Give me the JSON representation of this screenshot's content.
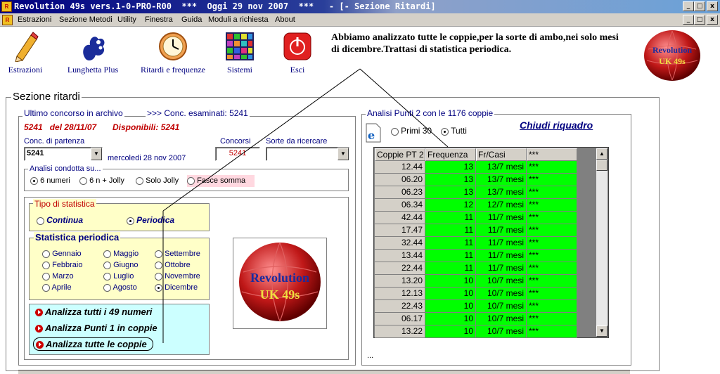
{
  "window": {
    "title": "Revolution 49s vers.1-0-PRO-R00  ***  Oggi 29 nov 2007  ***   - [- Sezione Ritardi]",
    "controls": [
      "_",
      "□",
      "x"
    ]
  },
  "menu": [
    "Estrazioni",
    "Sezione Metodi",
    "Utility",
    "Finestra",
    "Guida",
    "Moduli a richiesta",
    "About"
  ],
  "toolbar": [
    {
      "label": "Estrazioni",
      "icon": "pencil-icon"
    },
    {
      "label": "Lunghetta Plus",
      "icon": "lottery-hand-icon"
    },
    {
      "label": "Ritardi e frequenze",
      "icon": "clock-icon"
    },
    {
      "label": "Sistemi",
      "icon": "grid-icon"
    },
    {
      "label": "Esci",
      "icon": "power-icon"
    }
  ],
  "annotation": "Abbiamo analizzato tutte le coppie,per la sorte di ambo,nei solo mesi di dicembre.Trattasi di statistica periodica.",
  "logo": {
    "line1": "Revolution",
    "line2": "UK 49s"
  },
  "section_title": "Sezione ritardi",
  "left": {
    "frame_title": "Ultimo concorso in archivo",
    "examined": ">>> Conc. esaminati: 5241",
    "last_draw": "5241   del 28/11/07",
    "available": "Disponibili: 5241",
    "start_label": "Conc. di partenza",
    "start_value": "5241",
    "start_date": "mercoledi 28 nov 2007",
    "concorsi_label": "Concorsi",
    "concorsi_value": "5241",
    "sorte_label": "Sorte da ricercare",
    "sorte_value": "",
    "analisi_title": "Analisi condotta su...",
    "analisi_options": [
      "6 numeri",
      "6 n + Jolly",
      "Solo Jolly",
      "Fasce somma"
    ],
    "analisi_selected": "6 numeri",
    "tipo_title": "Tipo di statistica",
    "tipo_options": [
      "Continua",
      "Periodica"
    ],
    "tipo_selected": "Periodica",
    "periodica_title": "Statistica periodica",
    "months": [
      "Gennaio",
      "Febbraio",
      "Marzo",
      "Aprile",
      "Maggio",
      "Giugno",
      "Luglio",
      "Agosto",
      "Settembre",
      "Ottobre",
      "Novembre",
      "Dicembre"
    ],
    "month_selected": "Dicembre",
    "actions": [
      "Analizza tutti i 49 numeri",
      "Analizza Punti 1 in coppie",
      "Analizza tutte le coppie"
    ]
  },
  "right": {
    "frame_title": "Analisi Punti 2 con le 1176 coppie",
    "filter_options": [
      "Primi 30",
      "Tutti"
    ],
    "filter_selected": "Tutti",
    "close_link": "Chiudi riquadro",
    "columns": [
      "Coppie PT 2",
      "Frequenza",
      "Fr/Casi",
      "***"
    ],
    "rows": [
      [
        "12.44",
        "13",
        "13/7 mesi",
        "***"
      ],
      [
        "06.20",
        "13",
        "13/7 mesi",
        "***"
      ],
      [
        "06.23",
        "13",
        "13/7 mesi",
        "***"
      ],
      [
        "06.34",
        "12",
        "12/7 mesi",
        "***"
      ],
      [
        "42.44",
        "11",
        "11/7 mesi",
        "***"
      ],
      [
        "17.47",
        "11",
        "11/7 mesi",
        "***"
      ],
      [
        "32.44",
        "11",
        "11/7 mesi",
        "***"
      ],
      [
        "13.44",
        "11",
        "11/7 mesi",
        "***"
      ],
      [
        "22.44",
        "11",
        "11/7 mesi",
        "***"
      ],
      [
        "13.20",
        "10",
        "10/7 mesi",
        "***"
      ],
      [
        "12.13",
        "10",
        "10/7 mesi",
        "***"
      ],
      [
        "22.43",
        "10",
        "10/7 mesi",
        "***"
      ],
      [
        "06.17",
        "10",
        "10/7 mesi",
        "***"
      ],
      [
        "13.22",
        "10",
        "10/7 mesi",
        "***"
      ]
    ],
    "footer": "..."
  }
}
